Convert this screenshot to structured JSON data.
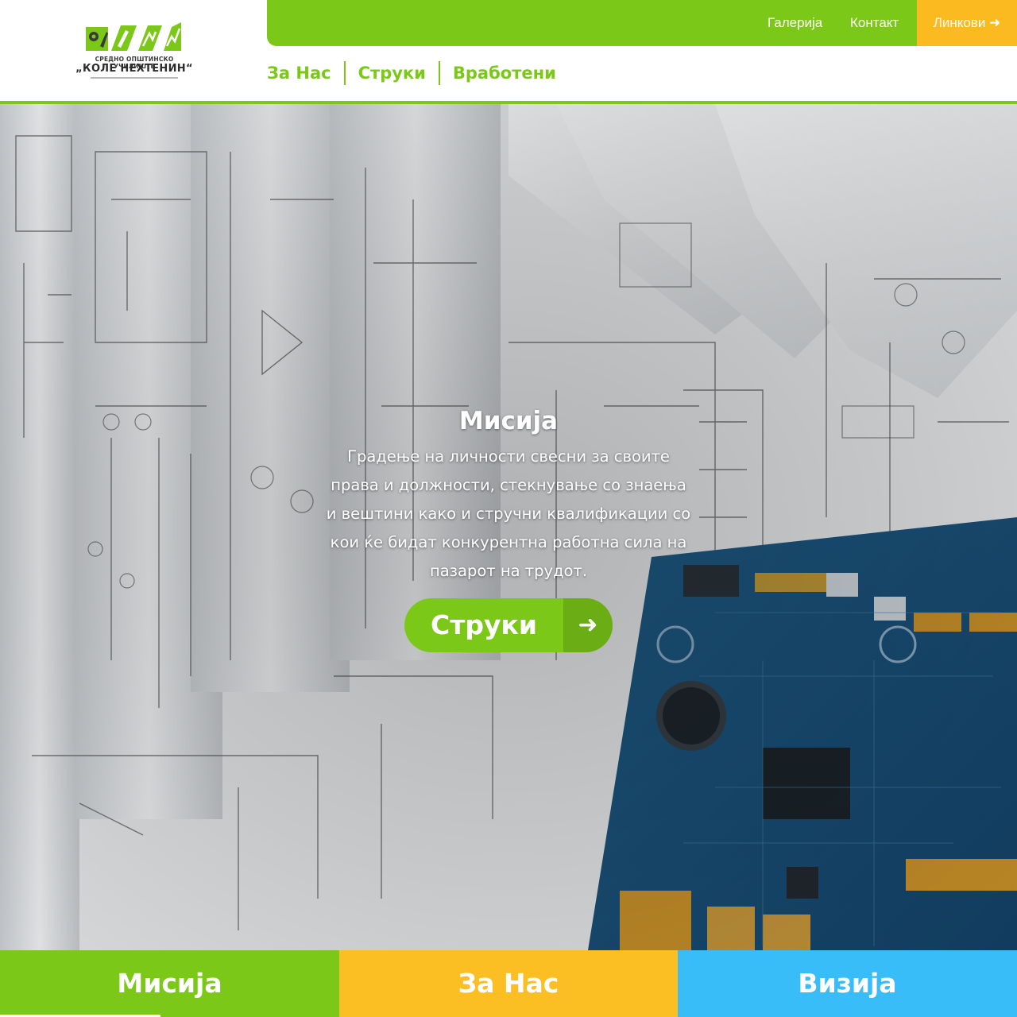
{
  "logo": {
    "subtitle": "СРЕДНО ОПШТИНСКО УЧИЛИШТЕ",
    "name": "„КОЛЕ НЕХТЕНИН“"
  },
  "topnav": {
    "gallery": "Галерија",
    "contact": "Контакт",
    "links": "Линкови ➜"
  },
  "mainnav": [
    "За Нас",
    "Струки",
    "Вработени"
  ],
  "hero": {
    "title": "Мисија",
    "text_lines": [
      "Градење на личности свесни за своите",
      "права и должности, стекнување со знаења",
      "и вештини како и стручни квалификации со",
      "кои ќе бидат конкурентна работна сила на",
      "пазарот на трудот."
    ],
    "button_label": "Струки",
    "button_icon": "arrow-right-icon"
  },
  "tabs": [
    "Мисија",
    "За Нас",
    "Визија"
  ],
  "colors": {
    "brand_green": "#7cc818",
    "accent_orange": "#fbba1f",
    "tab_yellow": "#fbbf24",
    "tab_blue": "#38bdf8"
  }
}
